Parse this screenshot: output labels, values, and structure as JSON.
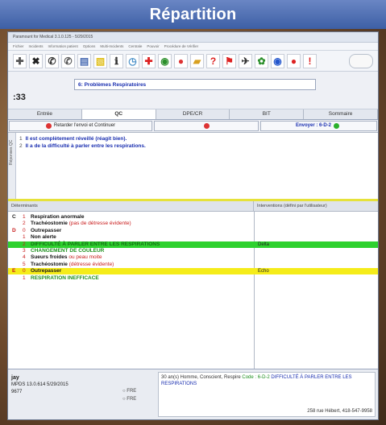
{
  "banner": {
    "title": "Répartition"
  },
  "window": {
    "title": "Paramount for Medical 3.1.0.125 - 5/29/2015",
    "menu": [
      "Fichier",
      "Incidents",
      "Information patient",
      "Options",
      "Multi-Incidents",
      "Centrale",
      "Pouvoir",
      "Procédure de Vérifier"
    ],
    "toolbar_icons": [
      "plus-icon",
      "close-x-icon",
      "phone-icon",
      "phone-alt-icon",
      "document-icon",
      "note-icon",
      "info-icon",
      "clock-icon",
      "ambulance-icon",
      "globe-icon",
      "red-circle-icon",
      "folder-icon",
      "help-icon",
      "flag-icon",
      "airplane-icon",
      "map-icon",
      "globe-blue-icon",
      "red-ball-icon",
      "alert-icon"
    ],
    "counter": ":33",
    "problem": "6: Problèmes Respiratoires",
    "tabs": [
      "Entrée",
      "QC",
      "DPE/CR",
      "BIT",
      "Sommaire"
    ],
    "active_tab": "QC",
    "actions": {
      "retarder": "Retarder l'envoi et Continuer",
      "envoyer": "Envoyer : 6-D-2"
    },
    "notes_label": "Réponses QC",
    "notes": [
      {
        "num": "1",
        "text": "Il est complètement réveillé (réagit bien)."
      },
      {
        "num": "2",
        "text": "Il a de la difficulté à parler entre les respirations."
      }
    ],
    "grid_headers": {
      "left": "Déterminants",
      "right": "Interventions (défini par l'utilisateur)"
    },
    "determinants": [
      {
        "letter": "C",
        "num": "1",
        "text": "Respiration anormale",
        "extra": "",
        "style": "black",
        "letter_style": "black"
      },
      {
        "letter": "",
        "num": "2",
        "text": "Trachéostomie",
        "extra": "(pas de détresse évidente)",
        "style": "black",
        "letter_style": "black"
      },
      {
        "letter": "D",
        "num": "0",
        "text": "Outrepasser",
        "extra": "",
        "style": "black",
        "letter_style": "red"
      },
      {
        "letter": "",
        "num": "1",
        "text": "Non alerte",
        "extra": "",
        "style": "black",
        "letter_style": "black"
      },
      {
        "letter": "",
        "num": "2",
        "text": "DIFFICULTÉ À PARLER ENTRE LES RESPIRATIONS",
        "extra": "",
        "style": "green-row",
        "letter_style": "black",
        "intervention": "Delta"
      },
      {
        "letter": "",
        "num": "3",
        "text": "CHANGEMENT DE COULEUR",
        "extra": "",
        "style": "green",
        "letter_style": "black"
      },
      {
        "letter": "",
        "num": "4",
        "text": "Sueurs froides",
        "extra": "ou peau moite",
        "style": "black",
        "letter_style": "black"
      },
      {
        "letter": "",
        "num": "5",
        "text": "Trachéostomie",
        "extra": "(détresse évidente)",
        "style": "black",
        "letter_style": "black"
      },
      {
        "letter": "E",
        "num": "0",
        "text": "Outrepasser",
        "extra": "",
        "style": "yellow-row",
        "letter_style": "red",
        "intervention": "Echo"
      },
      {
        "letter": "",
        "num": "1",
        "text": "RESPIRATION INEFFICACE",
        "extra": "",
        "style": "green",
        "letter_style": "black"
      }
    ],
    "footer": {
      "user": "jay",
      "line2": "MPDS 13.0.614 5/29/2015",
      "line3": "9677",
      "options": [
        "FRE",
        "FRE"
      ],
      "summary": "30 an(s) Homme, Conscient, Respire",
      "code_label": "Code : 6-D-2",
      "code_desc": "DIFFICULTÉ À PARLER ENTRE LES RESPIRATIONS",
      "address": "258 rue Hébert, 418-547-9958"
    }
  },
  "colors": {
    "banner": "#4a6cb3",
    "highlight_green": "#2ed12e",
    "highlight_yellow": "#f5ec1a",
    "text_blue": "#1a2fb0",
    "text_red": "#c81a1a"
  }
}
